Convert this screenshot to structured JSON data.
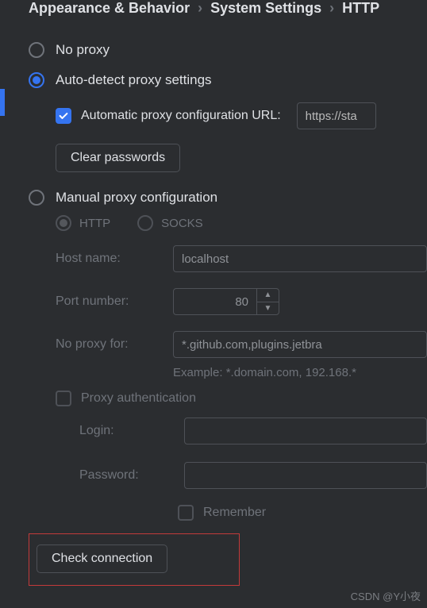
{
  "breadcrumb": {
    "part1": "Appearance & Behavior",
    "part2": "System Settings",
    "part3": "HTTP"
  },
  "proxy": {
    "no_proxy_label": "No proxy",
    "auto_detect_label": "Auto-detect proxy settings",
    "auto_url_label": "Automatic proxy configuration URL:",
    "auto_url_value": "https://sta",
    "clear_passwords_label": "Clear passwords",
    "manual_label": "Manual proxy configuration",
    "protocol": {
      "http_label": "HTTP",
      "socks_label": "SOCKS"
    },
    "host_label": "Host name:",
    "host_value": "localhost",
    "port_label": "Port number:",
    "port_value": "80",
    "noproxy_label": "No proxy for:",
    "noproxy_value": "*.github.com,plugins.jetbra",
    "example_hint": "Example: *.domain.com, 192.168.*",
    "auth_label": "Proxy authentication",
    "login_label": "Login:",
    "login_value": "",
    "password_label": "Password:",
    "password_value": "",
    "remember_label": "Remember",
    "check_label": "Check connection"
  },
  "watermark": "CSDN @Y小夜"
}
